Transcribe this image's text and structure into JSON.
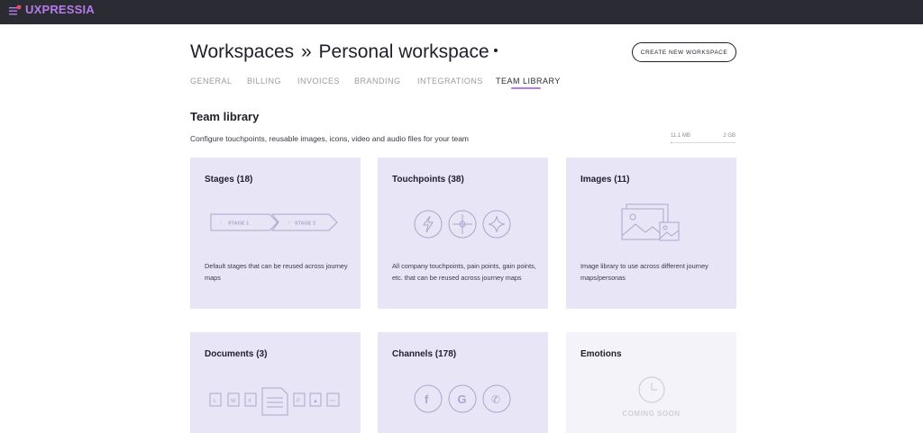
{
  "app": {
    "logo": "UXPRESSIA"
  },
  "header": {
    "breadcrumb_root": "Workspaces",
    "separator": "»",
    "workspace_name": "Personal workspace",
    "create_button": "CREATE NEW WORKSPACE"
  },
  "tabs": [
    {
      "label": "GENERAL",
      "active": false
    },
    {
      "label": "BILLING",
      "active": false
    },
    {
      "label": "INVOICES",
      "active": false
    },
    {
      "label": "BRANDING",
      "active": false
    },
    {
      "label": "INTEGRATIONS",
      "active": false
    },
    {
      "label": "TEAM LIBRARY",
      "active": true
    }
  ],
  "library": {
    "title": "Team library",
    "description": "Configure touchpoints, reusable images, icons, video and audio files for your team",
    "storage_used": "11.1 MB",
    "storage_total": "2 GB",
    "storage_fraction": 0.005
  },
  "cards": [
    {
      "title": "Stages (18)",
      "description": "Default stages that can be reused across journey maps",
      "stage1": "STAGE 1",
      "stage2": "STAGE 2"
    },
    {
      "title": "Touchpoints (38)",
      "description": "All company touchpoints, pain points, gain points, etc. that can be reused across journey maps"
    },
    {
      "title": "Images (11)",
      "description": "Image library to use across different journey maps/personas"
    },
    {
      "title": "Documents (3)",
      "description": "",
      "doc_labels": [
        "W",
        "X",
        "P",
        "TXT"
      ]
    },
    {
      "title": "Channels (178)",
      "description": ""
    },
    {
      "title": "Emotions",
      "description": "",
      "status": "COMING SOON"
    }
  ],
  "colors": {
    "topbar": "#2b2c33",
    "accent": "#b57be8",
    "card": "#e8e6f6",
    "icon_stroke": "#a9a6cc"
  }
}
